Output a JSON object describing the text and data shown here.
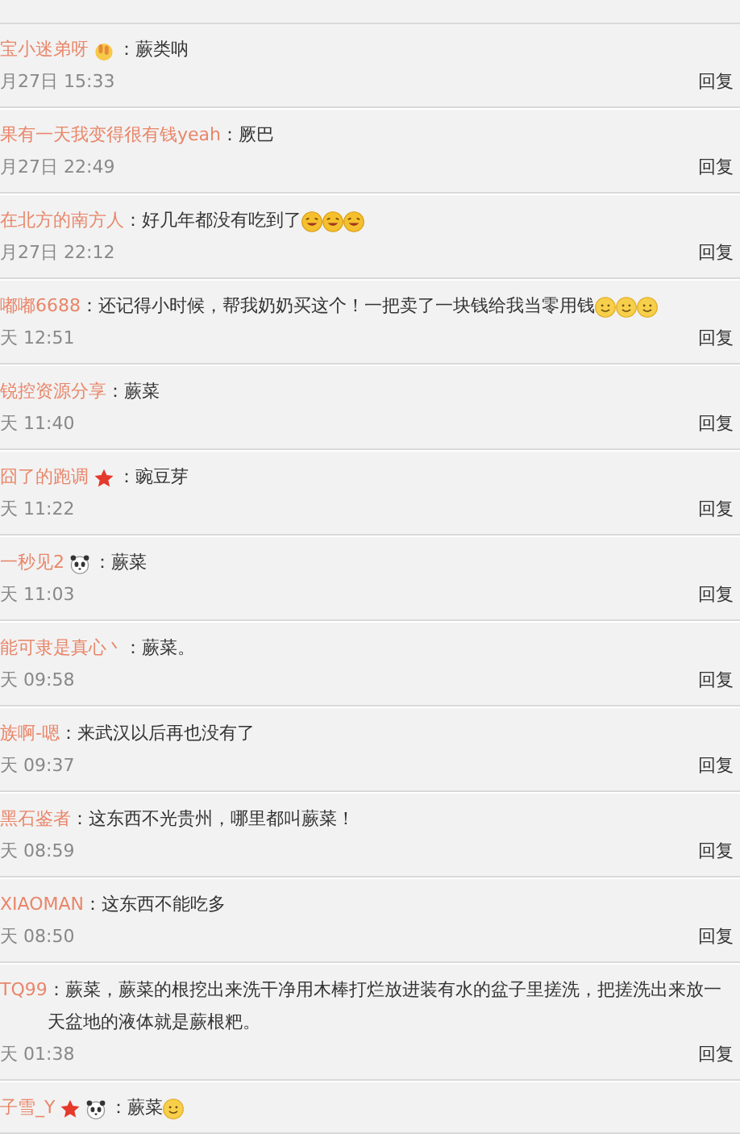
{
  "comments": [
    {
      "name": "宝小迷弟呀",
      "badges": [
        {
          "kind": "hands"
        }
      ],
      "text": "：蕨类呐",
      "time": "月27日 15:33",
      "reply": "回复"
    },
    {
      "name": "果有一天我变得很有钱yeah",
      "text": "：厥巴",
      "time": "月27日 22:49",
      "reply": "回复"
    },
    {
      "name": "在北方的南方人",
      "text": "：好几年都没有吃到了",
      "emojis": [
        {
          "kind": "laugh"
        },
        {
          "kind": "laugh"
        },
        {
          "kind": "laugh"
        }
      ],
      "time": "月27日 22:12",
      "reply": "回复"
    },
    {
      "name": "嘟嘟6688",
      "text": "：还记得小时候，帮我奶奶买这个！一把卖了一块钱给我当零用钱",
      "emojis": [
        {
          "kind": "smile"
        },
        {
          "kind": "smile"
        },
        {
          "kind": "smile"
        }
      ],
      "time": "天 12:51",
      "reply": "回复"
    },
    {
      "name": "锐控资源分享",
      "text": "：蕨菜",
      "time": "天 11:40",
      "reply": "回复"
    },
    {
      "name": "囧了的跑调",
      "badges": [
        {
          "kind": "star"
        }
      ],
      "text": "：豌豆芽",
      "time": "天 11:22",
      "reply": "回复"
    },
    {
      "name": "一秒见2",
      "badges": [
        {
          "kind": "panda"
        }
      ],
      "text": "：蕨菜",
      "time": "天 11:03",
      "reply": "回复"
    },
    {
      "name": "能可隶是真心丶",
      "text": "：蕨菜。",
      "time": "天 09:58",
      "reply": "回复"
    },
    {
      "name": "族啊-嗯",
      "text": "：来武汉以后再也没有了",
      "time": "天 09:37",
      "reply": "回复"
    },
    {
      "name": "黑石鉴者",
      "text": "：这东西不光贵州，哪里都叫蕨菜！",
      "time": "天 08:59",
      "reply": "回复"
    },
    {
      "name": "XIAOMAN",
      "text": "：这东西不能吃多",
      "time": "天 08:50",
      "reply": "回复"
    },
    {
      "name": "TQ99",
      "text": "：蕨菜，蕨菜的根挖出来洗干净用木棒打烂放进装有水的盆子里搓洗，把搓洗出来放一天盆地的液体就是蕨根粑。",
      "time": "天 01:38",
      "reply": "回复"
    },
    {
      "name": "子雪_Y",
      "badges": [
        {
          "kind": "star"
        },
        {
          "kind": "panda"
        }
      ],
      "text": "：蕨菜",
      "emojis": [
        {
          "kind": "smile"
        }
      ]
    }
  ]
}
